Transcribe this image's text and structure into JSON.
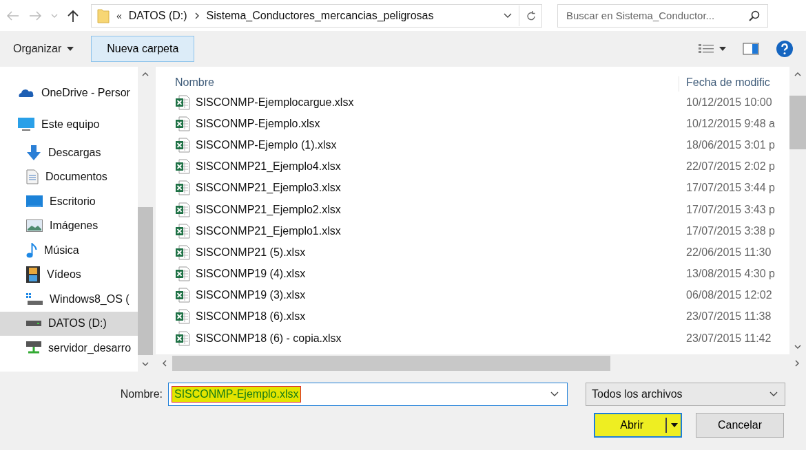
{
  "address_bar": {
    "overflow": "«",
    "path": [
      {
        "label": "DATOS (D:)"
      },
      {
        "label": "Sistema_Conductores_mercancias_peligrosas"
      }
    ],
    "search": {
      "placeholder": "Buscar en Sistema_Conductor..."
    }
  },
  "toolbar": {
    "organize": "Organizar",
    "new_folder": "Nueva carpeta"
  },
  "sidebar": {
    "items": [
      {
        "label": "OneDrive - Persor",
        "kind": "cloud",
        "selected": false
      },
      {
        "label": "Este equipo",
        "kind": "computer",
        "selected": false,
        "children": [
          {
            "label": "Descargas",
            "kind": "download",
            "selected": false
          },
          {
            "label": "Documentos",
            "kind": "document",
            "selected": false
          },
          {
            "label": "Escritorio",
            "kind": "desktop",
            "selected": false
          },
          {
            "label": "Imágenes",
            "kind": "image",
            "selected": false
          },
          {
            "label": "Música",
            "kind": "music",
            "selected": false
          },
          {
            "label": "Vídeos",
            "kind": "video",
            "selected": false
          },
          {
            "label": "Windows8_OS (",
            "kind": "osdrive",
            "selected": false
          },
          {
            "label": "DATOS (D:)",
            "kind": "drive",
            "selected": true
          },
          {
            "label": "servidor_desarro",
            "kind": "netdrive",
            "selected": false
          }
        ]
      }
    ]
  },
  "file_list": {
    "columns": [
      "Nombre",
      "Fecha de modific"
    ],
    "rows": [
      {
        "name": "SISCONMP-Ejemplocargue.xlsx",
        "date": "10/12/2015 10:00"
      },
      {
        "name": "SISCONMP-Ejemplo.xlsx",
        "date": "10/12/2015 9:48 a"
      },
      {
        "name": "SISCONMP-Ejemplo (1).xlsx",
        "date": "18/06/2015 3:01 p"
      },
      {
        "name": "SISCONMP21_Ejemplo4.xlsx",
        "date": "22/07/2015 2:02 p"
      },
      {
        "name": "SISCONMP21_Ejemplo3.xlsx",
        "date": "17/07/2015 3:44 p"
      },
      {
        "name": "SISCONMP21_Ejemplo2.xlsx",
        "date": "17/07/2015 3:43 p"
      },
      {
        "name": "SISCONMP21_Ejemplo1.xlsx",
        "date": "17/07/2015 3:38 p"
      },
      {
        "name": "SISCONMP21 (5).xlsx",
        "date": "22/06/2015 11:30"
      },
      {
        "name": "SISCONMP19 (4).xlsx",
        "date": "13/08/2015 4:30 p"
      },
      {
        "name": "SISCONMP19 (3).xlsx",
        "date": "06/08/2015 12:02"
      },
      {
        "name": "SISCONMP18 (6).xlsx",
        "date": "23/07/2015 11:38"
      },
      {
        "name": "SISCONMP18 (6) - copia.xlsx",
        "date": "23/07/2015 11:42"
      }
    ]
  },
  "footer": {
    "name_label": "Nombre:",
    "name_value": "SISCONMP-Ejemplo.xlsx",
    "name_highlighted": true,
    "filter": "Todos los archivos",
    "open_button": {
      "label": "Abrir",
      "highlighted": true
    },
    "cancel_button": "Cancelar"
  }
}
